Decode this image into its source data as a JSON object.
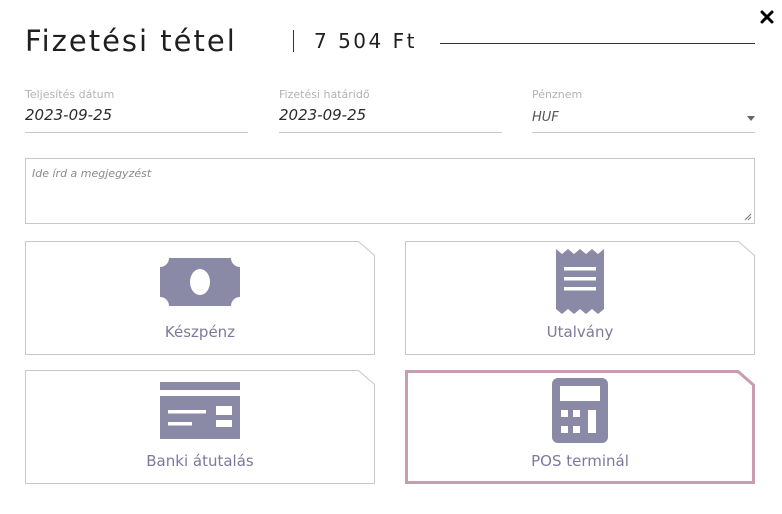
{
  "dialog": {
    "title": "Fizetési tétel",
    "amount": "7 504 Ft",
    "close_icon": "close-icon"
  },
  "fields": {
    "performance_date": {
      "label": "Teljesítés dátum",
      "value": "2023-09-25"
    },
    "due_date": {
      "label": "Fizetési határidő",
      "value": "2023-09-25"
    },
    "currency": {
      "label": "Pénznem",
      "value": "HUF"
    }
  },
  "note": {
    "placeholder": "Ide írd a megjegyzést"
  },
  "payment_methods": [
    {
      "label": "Készpénz",
      "icon": "cash-icon",
      "selected": false
    },
    {
      "label": "Utalvány",
      "icon": "voucher-receipt-icon",
      "selected": false
    },
    {
      "label": "Banki átutalás",
      "icon": "credit-card-icon",
      "selected": false
    },
    {
      "label": "POS terminál",
      "icon": "calculator-icon",
      "selected": true
    }
  ],
  "colors": {
    "icon": "#8b8aa6",
    "label": "#7a7a9e",
    "tile_border": "#c8c8c8",
    "selected_border": "#c79db0"
  }
}
